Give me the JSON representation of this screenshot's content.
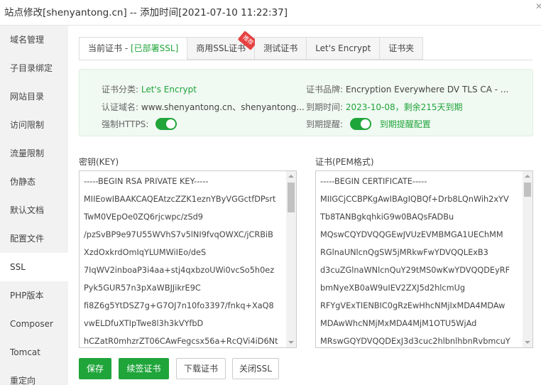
{
  "window": {
    "title": "站点修改[shenyantong.cn] -- 添加时间[2021-07-10 11:22:37]"
  },
  "sidebar": {
    "items": [
      {
        "label": "域名管理"
      },
      {
        "label": "子目录绑定"
      },
      {
        "label": "网站目录"
      },
      {
        "label": "访问限制"
      },
      {
        "label": "流量限制"
      },
      {
        "label": "伪静态"
      },
      {
        "label": "默认文档"
      },
      {
        "label": "配置文件"
      },
      {
        "label": "SSL"
      },
      {
        "label": "PHP版本"
      },
      {
        "label": "Composer"
      },
      {
        "label": "Tomcat"
      },
      {
        "label": "重定向"
      }
    ],
    "active": "SSL"
  },
  "tabs": {
    "current_cert": "当前证书 - ",
    "deployed": "[已部署SSL]",
    "commercial": "商用SSL证书",
    "commercial_badge": "推荐",
    "test": "测试证书",
    "letsencrypt": "Let's Encrypt",
    "folder": "证书夹"
  },
  "info": {
    "category_label": "证书分类:",
    "category_value": "Let's Encrypt",
    "brand_label": "证书品牌:",
    "brand_value": "Encryption Everywhere DV TLS CA - ...",
    "domain_label": "认证域名:",
    "domain_value": "www.shenyantong.cn、shenyantong...",
    "expire_label": "到期时间:",
    "expire_value": "2023-10-08，剩余215天到期",
    "https_label": "强制HTTPS:",
    "https_enabled": true,
    "remind_label": "到期提醒:",
    "remind_enabled": true,
    "remind_link": "到期提醒配置"
  },
  "key": {
    "label": "密钥(KEY)",
    "lines": [
      "-----BEGIN RSA PRIVATE KEY-----",
      "MIIEowIBAAKCAQEAtzcZZK1eznYByVGGctfDPsrt",
      "TwM0VEpOe0ZQ6rjcwpc/zSd9",
      "/pzSvBP9e97U55WVhS7v5lNI9fvqOWXC/jCRBiB",
      "XzdOxkrdOmIqYLUMWiIEo/deS",
      "7IqWV2inboaP3i4aa+stj4qxbzoUWi0vcSo5h0ez",
      "Pyk5GUR57n3pXaWBJJikrE9C",
      "fi8Z6g5YtDSZ7g+G7OJ7n10fo3397/fnkq+XaQ8",
      "vwELDfuXTIpTwe8l3h3kVYfbD",
      "hCZatR0mhzrZT06CAwFegcsx56a+RcQVi4iD6Nt"
    ]
  },
  "cert": {
    "label": "证书(PEM格式)",
    "lines": [
      "-----BEGIN CERTIFICATE-----",
      "MIIGCjCCBPKgAwIBAgIQBQf+Drb8LQnWih2xYV",
      "Tb8TANBgkqhkiG9w0BAQsFADBu",
      "MQswCQYDVQQGEwJVUzEVMBMGA1UEChMM",
      "RGlnaUNlcnQgSW5jMRkwFwYDVQQLExB3",
      "d3cuZGlnaWNlcnQuY29tMS0wKwYDVQQDEyRF",
      "bmNyeXB0aW9uIEV2ZXJ5d2hlcmUg",
      "RFYgVExTIENBIC0gRzEwHhcNMjIxMDA4MDAw",
      "MDAwWhcNMjMxMDA4MjM1OTU5WjAd",
      "MRswGQYDVQQDExJ3d3cuc2hlbnlhbnRvbmcuY"
    ]
  },
  "buttons": {
    "save": "保存",
    "renew": "续签证书",
    "download": "下载证书",
    "close_ssl": "关闭SSL"
  },
  "colors": {
    "accent": "#20a53a",
    "badge": "#e64242"
  }
}
